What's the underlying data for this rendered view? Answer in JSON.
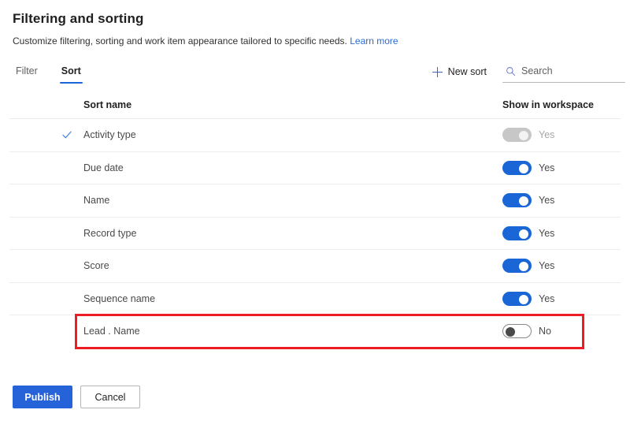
{
  "header": {
    "title": "Filtering and sorting",
    "subtitle": "Customize filtering, sorting and work item appearance tailored to specific needs.",
    "learn_more": "Learn more"
  },
  "tabs": [
    {
      "label": "Filter",
      "selected": false
    },
    {
      "label": "Sort",
      "selected": true
    }
  ],
  "toolbar": {
    "new_sort_label": "New sort",
    "search_placeholder": "Search",
    "search_value": ""
  },
  "table": {
    "columns": {
      "name": "Sort name",
      "show": "Show in workspace"
    },
    "rows": [
      {
        "name": "Activity type",
        "checked": true,
        "toggle_on": true,
        "toggle_disabled": true,
        "toggle_label": "Yes",
        "highlighted": false
      },
      {
        "name": "Due date",
        "checked": false,
        "toggle_on": true,
        "toggle_disabled": false,
        "toggle_label": "Yes",
        "highlighted": false
      },
      {
        "name": "Name",
        "checked": false,
        "toggle_on": true,
        "toggle_disabled": false,
        "toggle_label": "Yes",
        "highlighted": false
      },
      {
        "name": "Record type",
        "checked": false,
        "toggle_on": true,
        "toggle_disabled": false,
        "toggle_label": "Yes",
        "highlighted": false
      },
      {
        "name": "Score",
        "checked": false,
        "toggle_on": true,
        "toggle_disabled": false,
        "toggle_label": "Yes",
        "highlighted": false
      },
      {
        "name": "Sequence name",
        "checked": false,
        "toggle_on": true,
        "toggle_disabled": false,
        "toggle_label": "Yes",
        "highlighted": false
      },
      {
        "name": "Lead . Name",
        "checked": false,
        "toggle_on": false,
        "toggle_disabled": false,
        "toggle_label": "No",
        "highlighted": true
      }
    ]
  },
  "footer": {
    "publish_label": "Publish",
    "cancel_label": "Cancel"
  },
  "colors": {
    "accent_blue": "#1a66d6",
    "primary_button": "#2663d8",
    "link_blue": "#2b6bd4",
    "highlight_red": "#ee1c25",
    "toggle_off_border": "#8a8886",
    "toggle_disabled": "#c7c7c7"
  },
  "icons": {
    "search": "search-icon",
    "plus": "plus-icon",
    "check": "check-icon"
  }
}
